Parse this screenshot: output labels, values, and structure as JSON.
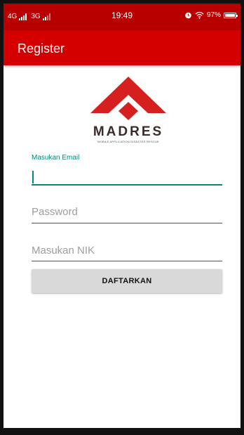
{
  "status_bar": {
    "network_1": "4G",
    "network_2": "3G",
    "time": "19:49",
    "battery": "97%",
    "battery_level": 0.97,
    "icons": [
      "alarm-icon",
      "wifi-icon",
      "battery-icon"
    ]
  },
  "app_bar": {
    "title": "Register"
  },
  "logo": {
    "wordmark": "MADRES",
    "subtitle": "MOBILE APPLICATION DISASTER RESCUE"
  },
  "form": {
    "email": {
      "label": "Masukan Email",
      "value": ""
    },
    "password": {
      "placeholder": "Password"
    },
    "nik": {
      "placeholder": "Masukan NIK"
    },
    "submit_label": "DAFTARKAN"
  },
  "colors": {
    "status_bar": "#b80000",
    "app_bar": "#d40000",
    "accent": "#00897b",
    "button": "#d9d9d9"
  }
}
